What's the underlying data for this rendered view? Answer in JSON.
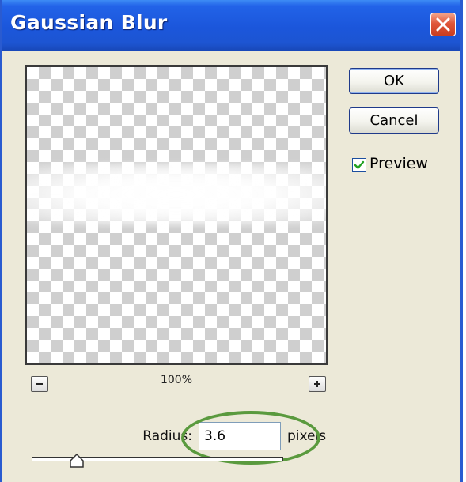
{
  "window": {
    "title": "Gaussian Blur"
  },
  "preview": {
    "zoom_level": "100%",
    "zoom_out_icon": "minus-icon",
    "zoom_in_icon": "plus-icon"
  },
  "buttons": {
    "ok_label": "OK",
    "cancel_label": "Cancel"
  },
  "preview_option": {
    "label": "Preview",
    "checked": true
  },
  "radius": {
    "label": "Radius:",
    "value": "3.6",
    "unit": "pixels",
    "slider_fraction": 0.18
  },
  "colors": {
    "titlebar": "#1b56db",
    "dialog_background": "#ece9d8",
    "close_button": "#e0563a",
    "highlight_annotation": "#5a9a3e"
  }
}
